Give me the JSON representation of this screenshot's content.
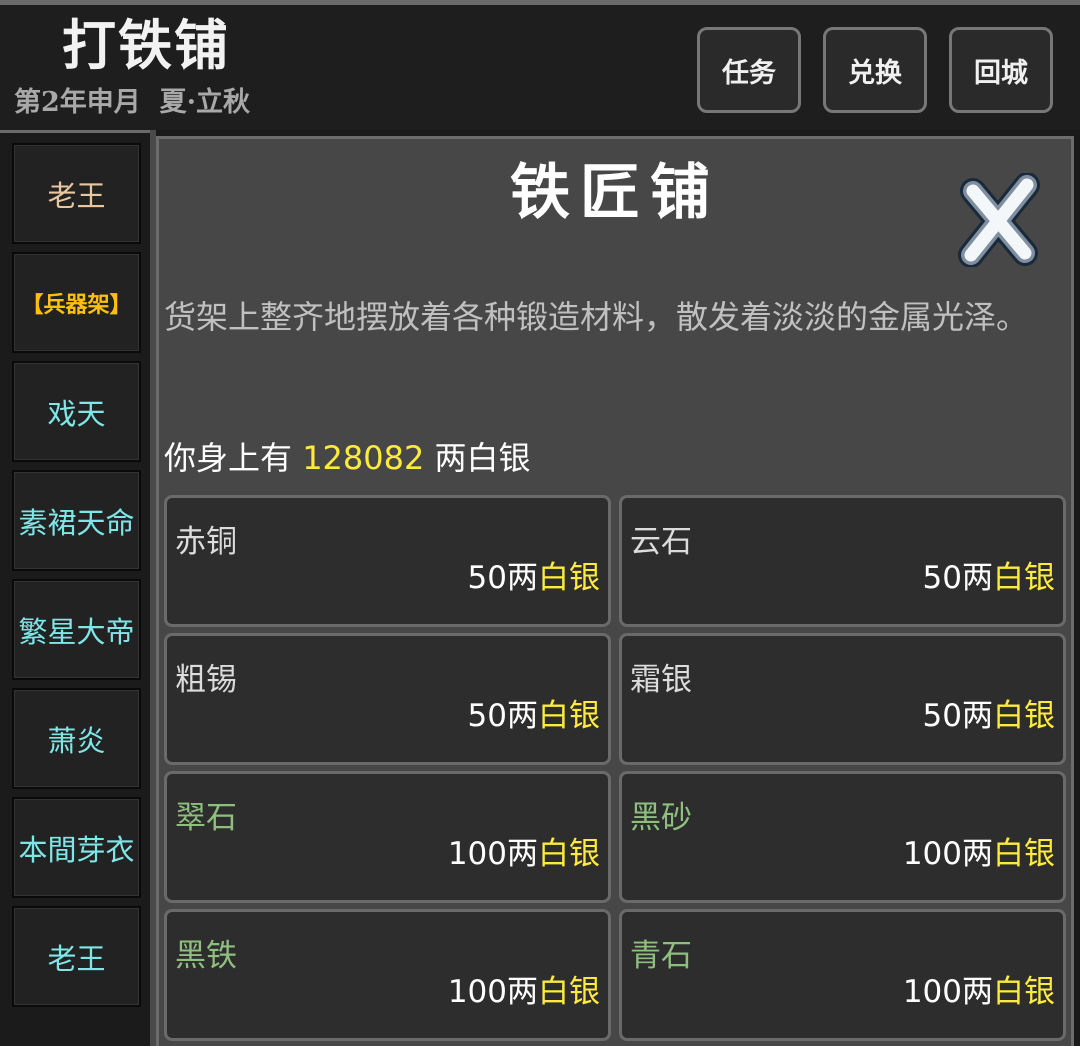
{
  "header": {
    "location_title": "打铁铺",
    "date": "第2年申月  夏·立秋",
    "buttons": {
      "quest": "任务",
      "exchange": "兑换",
      "return_city": "回城"
    }
  },
  "sidebar": {
    "items": [
      {
        "label": "老王"
      },
      {
        "label": "【兵器架】"
      },
      {
        "label": "戏天"
      },
      {
        "label": "素裙天命"
      },
      {
        "label": "繁星大帝"
      },
      {
        "label": "萧炎"
      },
      {
        "label": "本間芽衣"
      },
      {
        "label": "老王"
      }
    ]
  },
  "panel": {
    "title": "铁匠铺",
    "description": "货架上整齐地摆放着各种锻造材料，散发着淡淡的金属光泽。",
    "wallet": {
      "prefix": "你身上有 ",
      "amount": "128082",
      "suffix": " 两白银"
    },
    "currency": "白银",
    "goods": [
      {
        "name": "赤铜",
        "price": "50两"
      },
      {
        "name": "云石",
        "price": "50两"
      },
      {
        "name": "粗锡",
        "price": "50两"
      },
      {
        "name": "霜银",
        "price": "50两"
      },
      {
        "name": "翠石",
        "price": "100两"
      },
      {
        "name": "黑砂",
        "price": "100两"
      },
      {
        "name": "黑铁",
        "price": "100两"
      },
      {
        "name": "青石",
        "price": "100两"
      }
    ]
  },
  "colors": {
    "npc_name": "#7fe6e8",
    "npc_elder": "#e8c6a0",
    "weapon_rack": "#ffc107",
    "silver_amount": "#ffeb3b",
    "tier1_item": "#dcdcdc",
    "tier2_item": "#8fbf7f"
  },
  "icons": {
    "close": "close-x-icon"
  }
}
